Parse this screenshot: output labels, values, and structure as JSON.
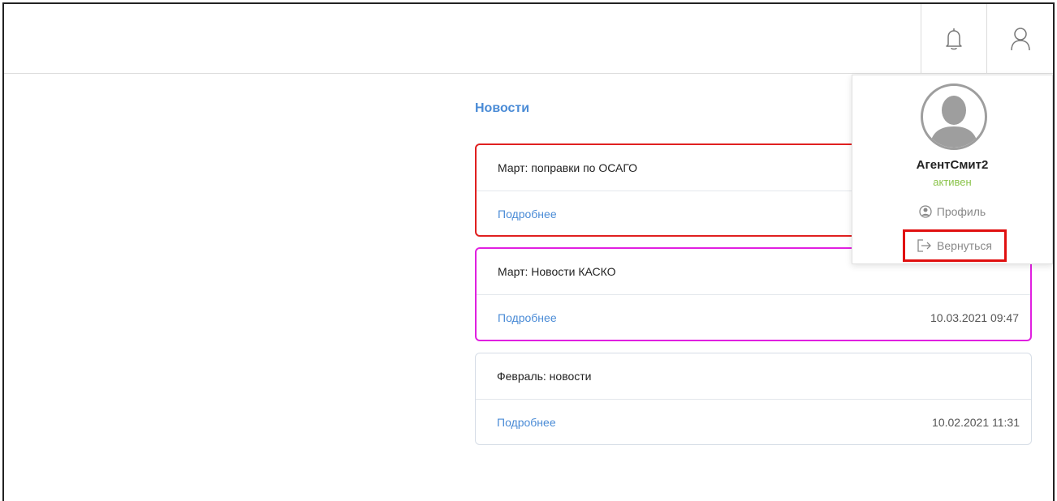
{
  "header": {
    "bell_icon": "bell-icon",
    "user_icon": "user-icon"
  },
  "news": {
    "title": "Новости",
    "items": [
      {
        "title": "Март: поправки по ОСАГО",
        "link": "Подробнее",
        "date": ""
      },
      {
        "title": "Март: Новости КАСКО",
        "link": "Подробнее",
        "date": "10.03.2021 09:47"
      },
      {
        "title": "Февраль: новости",
        "link": "Подробнее",
        "date": "10.02.2021 11:31"
      }
    ]
  },
  "user_menu": {
    "username": "АгентСмит2",
    "status": "активен",
    "profile_label": "Профиль",
    "back_label": "Вернуться"
  },
  "colors": {
    "accent": "#4a8bd6",
    "status_active": "#8ac34a",
    "highlight_red": "#e02020",
    "highlight_magenta": "#e020e0"
  }
}
